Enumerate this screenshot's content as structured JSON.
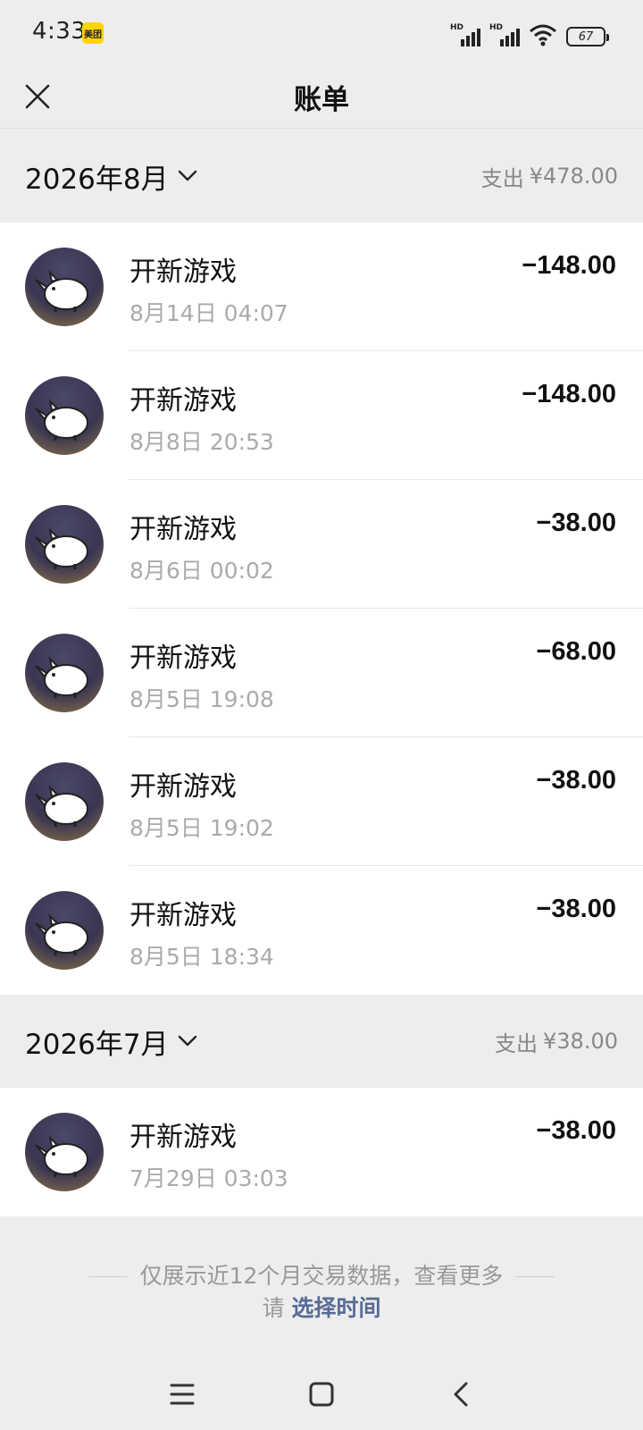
{
  "status_bar": {
    "time": "4:33",
    "app_badge": "美团",
    "hd_label": "HD",
    "battery": "67"
  },
  "nav": {
    "title": "账单"
  },
  "months": [
    {
      "label": "2026年8月",
      "total_prefix": "支出",
      "total": "¥478.00",
      "transactions": [
        {
          "merchant": "开新游戏",
          "datetime": "8月14日 04:07",
          "amount": "−148.00"
        },
        {
          "merchant": "开新游戏",
          "datetime": "8月8日 20:53",
          "amount": "−148.00"
        },
        {
          "merchant": "开新游戏",
          "datetime": "8月6日 00:02",
          "amount": "−38.00"
        },
        {
          "merchant": "开新游戏",
          "datetime": "8月5日 19:08",
          "amount": "−68.00"
        },
        {
          "merchant": "开新游戏",
          "datetime": "8月5日 19:02",
          "amount": "−38.00"
        },
        {
          "merchant": "开新游戏",
          "datetime": "8月5日 18:34",
          "amount": "−38.00"
        }
      ]
    },
    {
      "label": "2026年7月",
      "total_prefix": "支出",
      "total": "¥38.00",
      "transactions": [
        {
          "merchant": "开新游戏",
          "datetime": "7月29日 03:03",
          "amount": "−38.00"
        }
      ]
    }
  ],
  "footer": {
    "note_line1": "仅展示近12个月交易数据，查看更多",
    "note_prefix": "请",
    "note_link": "选择时间"
  },
  "icons": {
    "close": "close-icon",
    "chevron": "chevron-down-icon",
    "avatar": "rhino-avatar",
    "menu": "menu-icon",
    "home": "home-icon",
    "back": "back-icon"
  },
  "colors": {
    "background": "#ededed",
    "link": "#576b95",
    "secondary_text": "#aaaaaa"
  }
}
